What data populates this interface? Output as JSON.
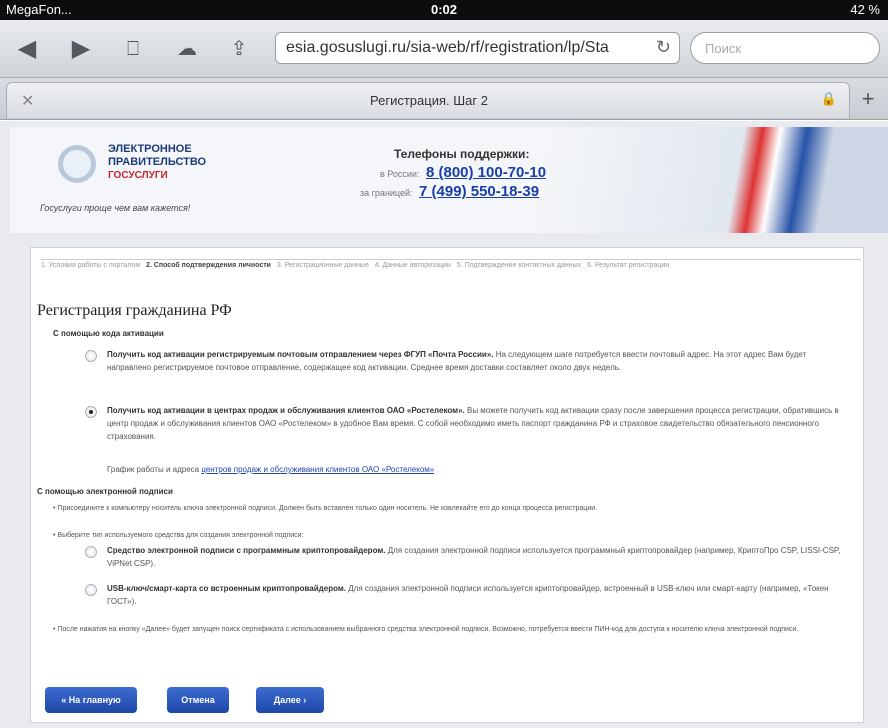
{
  "status": {
    "carrier": "MegaFon...",
    "time": "0:02",
    "battery": "42 %"
  },
  "browser": {
    "url": "esia.gosuslugi.ru/sia-web/rf/registration/lp/Sta",
    "search_placeholder": "Поиск",
    "tab_title": "Регистрация. Шаг 2"
  },
  "header": {
    "logo_line1": "ЭЛЕКТРОННОЕ",
    "logo_line2": "ПРАВИТЕЛЬСТВО",
    "logo_line3": "ГОСУСЛУГИ",
    "slogan": "Госуслуги проще чем вам кажется!",
    "support_title": "Телефоны поддержки:",
    "support_ru_label": "в России:",
    "support_ru_phone": "8 (800) 100-70-10",
    "support_intl_label": "за границей:",
    "support_intl_phone": "7 (499) 550-18-39"
  },
  "steps": [
    "1. Условия работы с порталом",
    "2. Способ подтверждения личности",
    "3. Регистрационные данные",
    "4. Данные авторизации",
    "5. Подтверждение контактных данных",
    "6. Результат регистрации"
  ],
  "main": {
    "title": "Регистрация гражданина РФ",
    "section_code": "С помощью кода активации",
    "opt1_bold": "Получить код активации регистрируемым почтовым отправлением через ФГУП «Почта России».",
    "opt1_text": "На следующем шаге потребуется ввести почтовый адрес. На этот адрес Вам будет направлено регистрируемое почтовое отправление, содержащее код активации. Среднее время доставки составляет около двух недель.",
    "opt2_bold": "Получить код активации в центрах продаж и обслуживания клиентов ОАО «Ростелеком».",
    "opt2_text": "Вы можете получить код активации сразу после завершения процесса регистрации, обратившись в центр продаж и обслуживания клиентов ОАО «Ростелеком» в удобное Вам время. С собой необходимо иметь паспорт гражданина РФ и страховое свидетельство обязательного пенсионного страхования.",
    "opt2_schedule": "График работы и адреса",
    "opt2_link": "центров продаж и обслуживания клиентов ОАО «Ростелеком»",
    "section_sign": "С помощью электронной подписи",
    "bullet1": "Присоедините к компьютеру носитель ключа электронной подписи. Должен быть вставлен только один носитель. Не извлекайте его до конца процесса регистрации.",
    "bullet2": "Выберите тип используемого средства для создания электронной подписи:",
    "sign1_bold": "Средство электронной подписи с программным криптопровайдером.",
    "sign1_text": "Для создания электронной подписи используется программный криптопровайдер (например, КриптоПро CSP, LISSI-CSP, ViPNet CSP).",
    "sign2_bold": "USB-ключ/смарт-карта со встроенным криптопровайдером.",
    "sign2_text": "Для создания электронной подписи используется криптопровайдер, встроенный в USB-ключ или смарт-карту (например, «Токен ГОСТ»).",
    "bullet3": "После нажатия на кнопку «Далее» будет запущен поиск сертификата с использованием выбранного средства электронной подписи. Возможно, потребуется ввести ПИН-код для доступа к носителю ключа электронной подписи."
  },
  "buttons": {
    "home": "« На главную",
    "cancel": "Отмена",
    "next": "Далее ›"
  }
}
